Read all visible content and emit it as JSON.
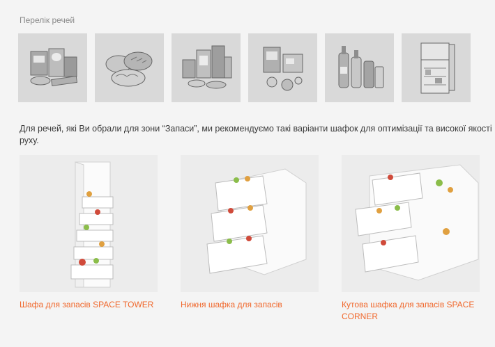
{
  "section": {
    "title": "Перелік речей"
  },
  "items": [
    {
      "icon": "boxed-foods-icon"
    },
    {
      "icon": "bread-icon"
    },
    {
      "icon": "canned-goods-icon"
    },
    {
      "icon": "appliances-icon"
    },
    {
      "icon": "bottles-icon"
    },
    {
      "icon": "refrigerator-icon"
    }
  ],
  "description": "Для речей, які Ви обрали для зони “Запаси”, ми рекомендуємо такі варіанти шафок для оптимізації та високої якості руху.",
  "cabinets": [
    {
      "label": "Шафа для запасів SPACE TOWER"
    },
    {
      "label": "Нижня шафка для запасів"
    },
    {
      "label": "Кутова шафка для запасів SPACE CORNER"
    }
  ],
  "colors": {
    "accent": "#f0672b",
    "tile_bg": "#d9d9d9",
    "page_bg": "#f4f4f4"
  }
}
